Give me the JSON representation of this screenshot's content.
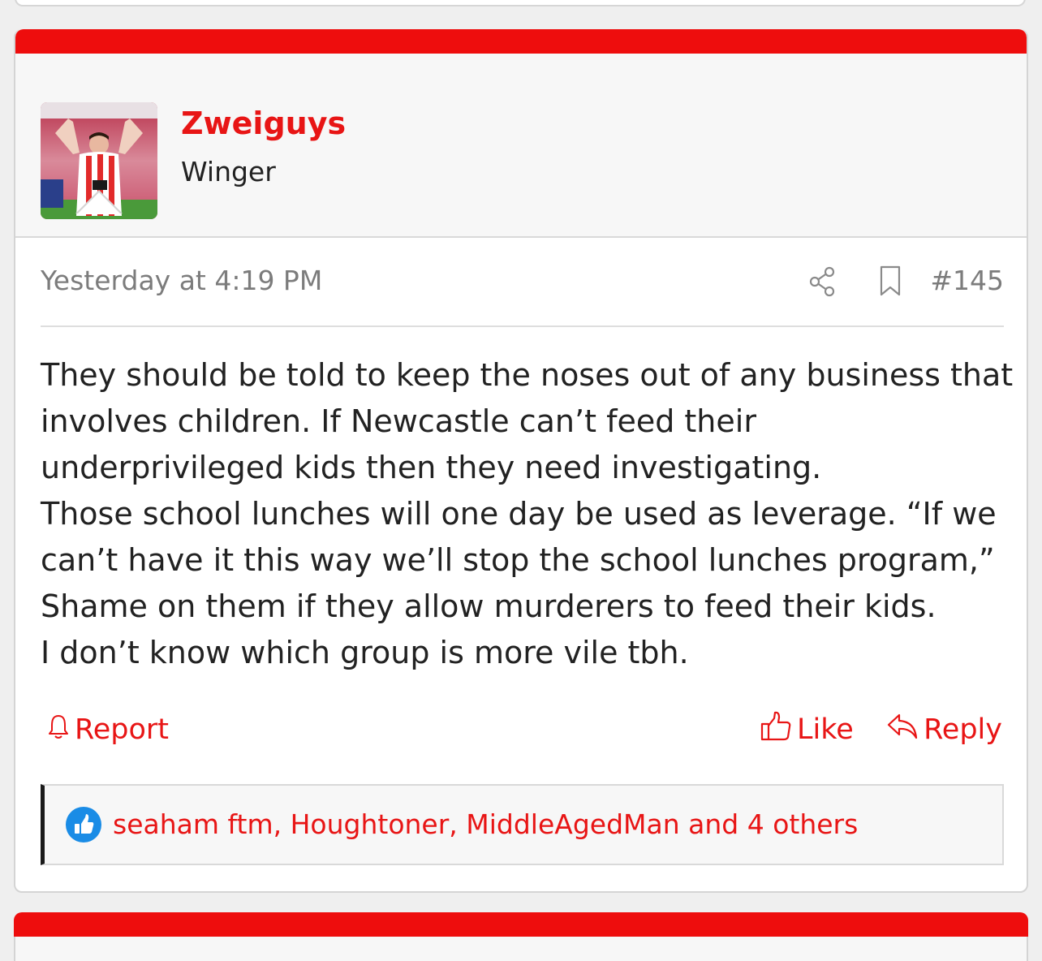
{
  "post": {
    "username": "Zweiguys",
    "user_title": "Winger",
    "date": "Yesterday at 4:19 PM",
    "number": "#145",
    "body_lines": [
      "They should be told to keep the noses out of any business that",
      "involves children. If Newcastle can’t feed their",
      "underprivileged kids then they need investigating.",
      "Those school lunches will one day be used as leverage. “If we",
      "can’t have it this way we’ll stop the school lunches program,”",
      "Shame on them if they allow murderers to feed their kids.",
      "I don’t know which group is more vile tbh."
    ],
    "actions": {
      "report": "Report",
      "like": "Like",
      "reply": "Reply"
    },
    "reactions": {
      "users_text": "seaham ftm, Houghtoner, MiddleAgedMan and 4 others"
    },
    "icons": {
      "share": "share-icon",
      "bookmark": "bookmark-icon",
      "bell": "bell-icon",
      "thumbs_up": "thumbs-up-icon",
      "reply": "reply-arrow-icon"
    },
    "colors": {
      "accent": "#ee0d0d",
      "link": "#e81515",
      "like_badge": "#1a8ce6"
    }
  }
}
